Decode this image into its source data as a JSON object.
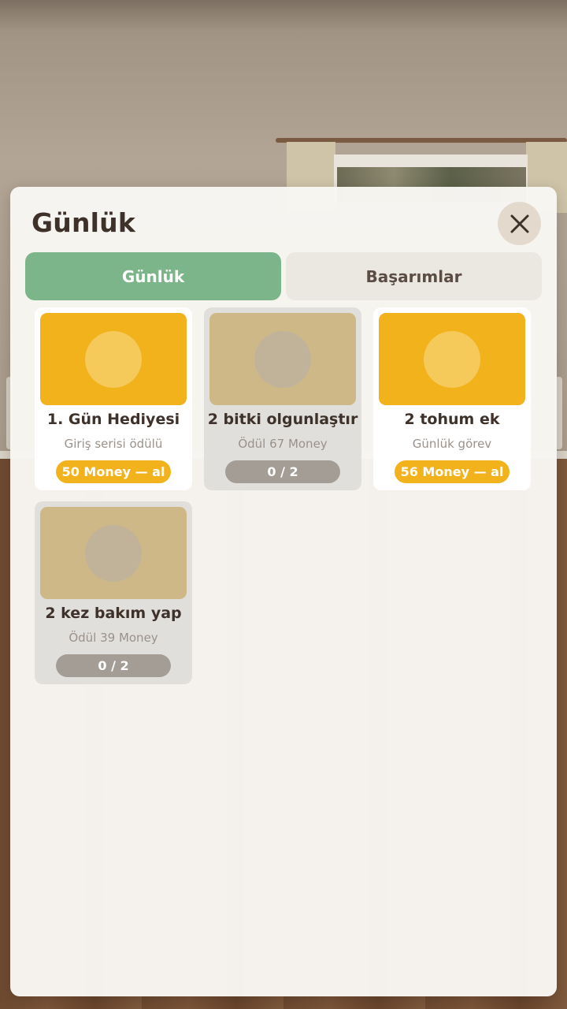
{
  "panel": {
    "title": "Günlük",
    "close_icon": "close-icon"
  },
  "tabs": [
    {
      "label": "Günlük",
      "active": true
    },
    {
      "label": "Başarımlar",
      "active": false
    }
  ],
  "colors": {
    "tab_active": "#7db58a",
    "card_reward": "#f2b21c",
    "card_locked": "#cfb887",
    "progress_pill": "#a39d96"
  },
  "cards": [
    {
      "title": "1. Gün Hediyesi",
      "subtitle": "Giriş serisi ödülü",
      "button": "50 Money — al",
      "state": "claimable"
    },
    {
      "title": "2 bitki olgunlaştır",
      "subtitle": "Ödül 67 Money",
      "button": "0 / 2",
      "state": "in-progress"
    },
    {
      "title": "2 tohum ek",
      "subtitle": "Günlük görev",
      "button": "56 Money — al",
      "state": "claimable"
    },
    {
      "title": "2 kez bakım yap",
      "subtitle": "Ödül 39 Money",
      "button": "0 / 2",
      "state": "in-progress"
    }
  ]
}
